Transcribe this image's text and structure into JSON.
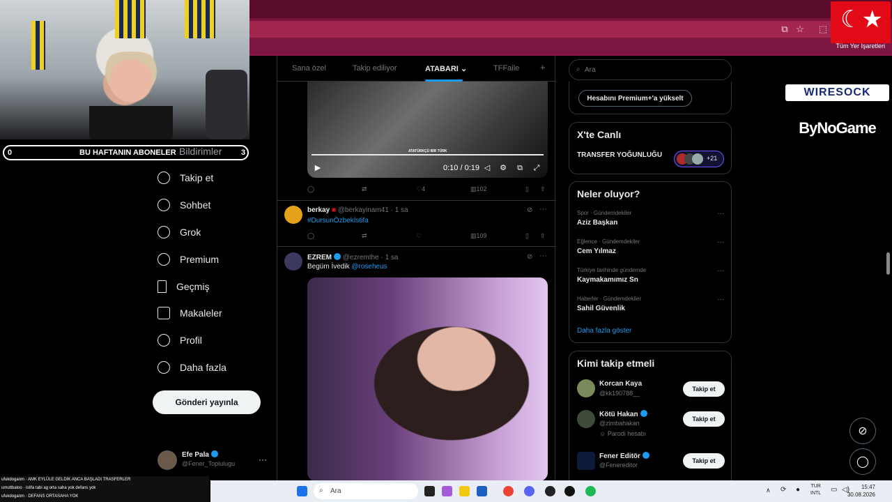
{
  "stream_overlay": {
    "subs_bar": {
      "left_count": "0",
      "label": "BU HAFTANIN ABONELER",
      "right_count": "3"
    },
    "flag_symbol": "☾★",
    "sponsors": [
      "WIRESOCK",
      "ByNoGame"
    ],
    "chat_lines": [
      "ufukdoganm · AMK EYLÜLE GELDİK ANCA BAŞLADI TRASFERLER",
      "umuttbaloo · istifa tabi ag orta saha yok defans yok",
      "ufukdoganm · DEFANS ORTASAHA YOK"
    ]
  },
  "browser": {
    "bookmarks_label": "Tüm Yer İşaretleri",
    "icons": [
      "cast-icon",
      "star-icon",
      "extensions-icon"
    ]
  },
  "sidebar": {
    "partial_item": "Bildirimler",
    "items": [
      {
        "label": "Takip et",
        "icon": "add-user-icon"
      },
      {
        "label": "Sohbet",
        "icon": "chat-icon"
      },
      {
        "label": "Grok",
        "icon": "grok-icon"
      },
      {
        "label": "Premium",
        "icon": "premium-icon"
      },
      {
        "label": "Geçmiş",
        "icon": "bookmark-icon"
      },
      {
        "label": "Makaleler",
        "icon": "articles-icon"
      },
      {
        "label": "Profil",
        "icon": "profile-icon"
      },
      {
        "label": "Daha fazla",
        "icon": "more-icon"
      }
    ],
    "post_button": "Gönderi yayınla",
    "profile": {
      "name": "Efe Pala",
      "handle": "@Fener_Toplulugu"
    }
  },
  "timeline": {
    "tabs": [
      "Sana özel",
      "Takip ediliyor",
      "ATABARI",
      "TFFaile"
    ],
    "active_tab": "ATABARI",
    "video": {
      "caption": "ATATÜRKÇÜ BİR TÜRK",
      "time": "0:10 / 0:19",
      "progress": 1.0
    },
    "tweet1_actions": {
      "likes": "4",
      "views": "102"
    },
    "tweet2": {
      "name": "berkay",
      "handle": "@berkayinam41",
      "time": "· 1 sa",
      "text": "#DursunÖzbekİstifa",
      "views": "109"
    },
    "tweet3": {
      "name": "EZREM",
      "handle": "@ezremthe",
      "time": "· 1 sa",
      "text": "Begüm İvedik",
      "mention": "@roseheus"
    }
  },
  "right": {
    "search_placeholder": "Ara",
    "premium_button": "Hesabını Premium+'a yükselt",
    "live": {
      "title": "X'te Canlı",
      "item": "TRANSFER YOĞUNLUĞU",
      "count": "+21"
    },
    "trends": {
      "title": "Neler oluyor?",
      "items": [
        {
          "category": "Spor · Gündemdekiler",
          "name": "Aziz Başkan"
        },
        {
          "category": "Eğlence · Gündemdekiler",
          "name": "Cem Yılmaz"
        },
        {
          "category": "Türkiye tarihinde gündemde",
          "name": "Kaymakamımız Sn"
        },
        {
          "category": "Haberler · Gündemdekiler",
          "name": "Sahil Güvenlik"
        }
      ],
      "show_more": "Daha fazla göster"
    },
    "who_to_follow": {
      "title": "Kimi takip etmeli",
      "button": "Takip et",
      "items": [
        {
          "name": "Korcan Kaya",
          "handle": "@kk190788__"
        },
        {
          "name": "Kötü Hakan",
          "handle": "@zimbahakan",
          "note": "Parodi hesabı"
        },
        {
          "name": "Fener Editör",
          "handle": "@Fenereditor"
        }
      ]
    }
  },
  "taskbar": {
    "search": "Ara",
    "lang": "TUR",
    "layout": "INTL",
    "time": "15:47",
    "date": "30.08.2026"
  }
}
